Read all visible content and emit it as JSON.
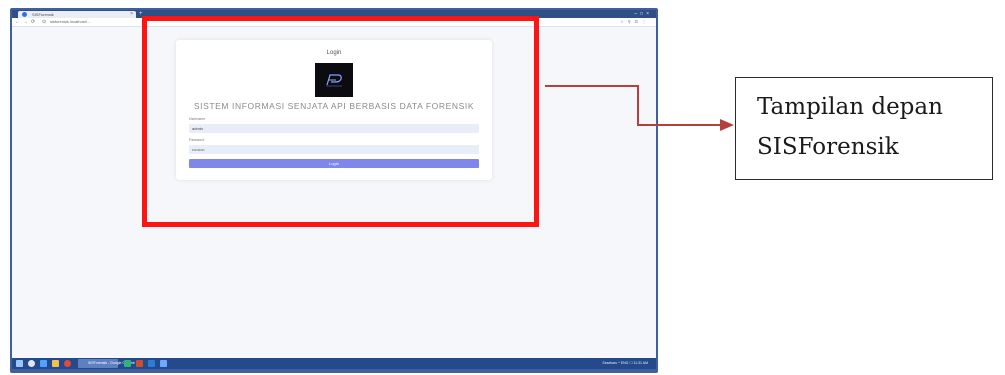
{
  "browser": {
    "tab_title": "SISForensik",
    "url": "sisforensik.localhost/..."
  },
  "login_card": {
    "title": "Login",
    "heading": "SISTEM INFORMASI SENJATA API BERBASIS DATA FORENSIK",
    "username_label": "Username",
    "username_value": "admin",
    "password_label": "Password",
    "password_value": "•••••••••",
    "login_button": "Login"
  },
  "taskbar": {
    "active_app": "SISForensik - Google Chrome",
    "tray_text": "Sesekaru   ^  ENG  ☐  11:31 AM"
  },
  "callout": {
    "line1": "Tampilan depan",
    "line2": "SISForensik"
  },
  "colors": {
    "highlight": "#ff1414",
    "arrow": "#b5413e",
    "login_button": "#7f87ea",
    "field_bg": "#e8edf7"
  }
}
